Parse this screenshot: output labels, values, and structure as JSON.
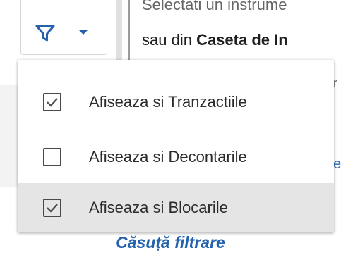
{
  "background_text": {
    "line1": "Selectati un instrume",
    "line2_prefix": "sau din ",
    "line2_bold": "Caseta de In",
    "peek_right": "r",
    "peek_link": "e"
  },
  "toolbar": {
    "filter_button_icon": "filter-icon",
    "caret_icon": "chevron-down-icon"
  },
  "filter_menu": {
    "items": [
      {
        "label": "Afiseaza si Tranzactiile",
        "checked": true,
        "highlighted": false
      },
      {
        "label": "Afiseaza si Decontarile",
        "checked": false,
        "highlighted": false
      },
      {
        "label": "Afiseaza si Blocarile",
        "checked": true,
        "highlighted": true
      }
    ]
  },
  "caption": "Căsuță filtrare",
  "colors": {
    "accent_blue": "#2462ae",
    "hover_gray": "#e5e5e5",
    "checkbox_border": "#4a4a4a"
  }
}
